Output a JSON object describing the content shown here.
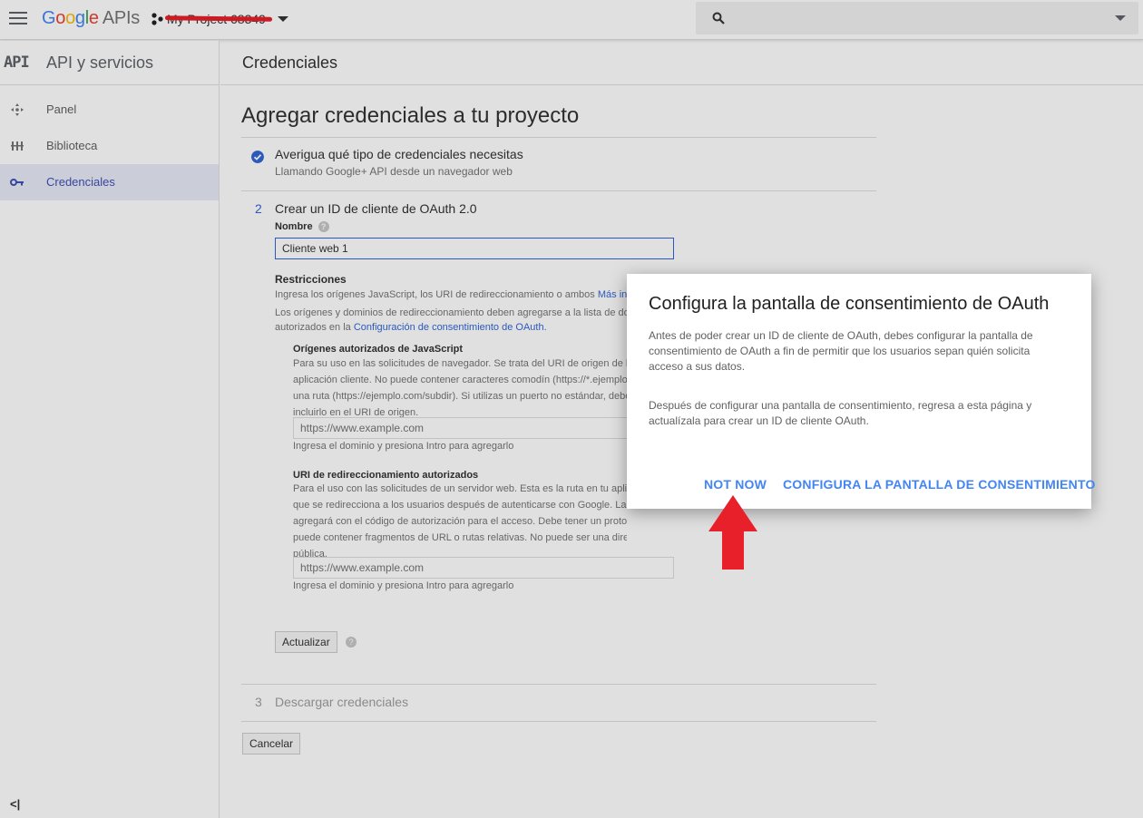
{
  "topbar": {
    "logo_letters": [
      "G",
      "o",
      "o",
      "g",
      "l",
      "e"
    ],
    "logo_suffix": "APIs",
    "project_name": "My Project 68349"
  },
  "sidebar": {
    "api_mark": "API",
    "title": "API y servicios",
    "items": [
      {
        "label": "Panel",
        "icon": "dashboard-icon"
      },
      {
        "label": "Biblioteca",
        "icon": "library-icon"
      },
      {
        "label": "Credenciales",
        "icon": "key-icon",
        "active": true
      }
    ],
    "collapse_glyph": "<|"
  },
  "subheader": {
    "title": "Credenciales"
  },
  "main": {
    "heading": "Agregar credenciales a tu proyecto",
    "step1": {
      "title": "Averigua qué tipo de credenciales necesitas",
      "subtitle": "Llamando Google+ API desde un navegador web"
    },
    "step2": {
      "number": "2",
      "title": "Crear un ID de cliente de OAuth 2.0",
      "name_label": "Nombre",
      "name_value": "Cliente web 1",
      "restrictions_label": "Restricciones",
      "restrictions_text": "Ingresa los orígenes JavaScript, los URI de redireccionamiento o ambos",
      "restrictions_link": "Más información",
      "restrictions_text2": "Los orígenes y dominios de redireccionamiento deben agregarse a la lista de dominios",
      "restrictions_text3": "autorizados en la",
      "restrictions_link2": "Configuración de consentimiento de OAuth.",
      "js_origins_label": "Orígenes autorizados de JavaScript",
      "js_origins_lines": [
        "Para su uso en las solicitudes de navegador. Se trata del URI de origen de la",
        "aplicación cliente. No puede contener caracteres comodín (https://*.ejemplo.com) o",
        "una ruta (https://ejemplo.com/subdir). Si utilizas un puerto no estándar, debes",
        "incluirlo en el URI de origen."
      ],
      "js_origins_placeholder": "https://www.example.com",
      "js_origins_hint": "Ingresa el dominio y presiona Intro para agregarlo",
      "redirect_label": "URI de redireccionamiento autorizados",
      "redirect_lines": [
        "Para el uso con las solicitudes de un servidor web. Esta es la ruta en tu aplicación",
        "que se redirecciona a los usuarios después de autenticarse con Google. La ruta se",
        "agregará con el código de autorización para el acceso. Debe tener un protocolo. No",
        "puede contener fragmentos de URL o rutas relativas. No puede ser una dirección IP",
        "pública."
      ],
      "redirect_placeholder": "https://www.example.com",
      "redirect_hint": "Ingresa el dominio y presiona Intro para agregarlo",
      "update_button": "Actualizar"
    },
    "step3": {
      "number": "3",
      "title": "Descargar credenciales"
    },
    "cancel_button": "Cancelar"
  },
  "dialog": {
    "title": "Configura la pantalla de consentimiento de OAuth",
    "paragraph1": "Antes de poder crear un ID de cliente de OAuth, debes configurar la pantalla de consentimiento de OAuth a fin de permitir que los usuarios sepan quién solicita acceso a sus datos.",
    "paragraph2": "Después de configurar una pantalla de consentimiento, regresa a esta página y actualízala para crear un ID de cliente OAuth.",
    "not_now": "NOT NOW",
    "configure": "CONFIGURA LA PANTALLA DE CONSENTIMIENTO"
  },
  "colors": {
    "accent": "#4285f4",
    "annotation_arrow": "#e8202a",
    "redaction": "#e8202a"
  }
}
